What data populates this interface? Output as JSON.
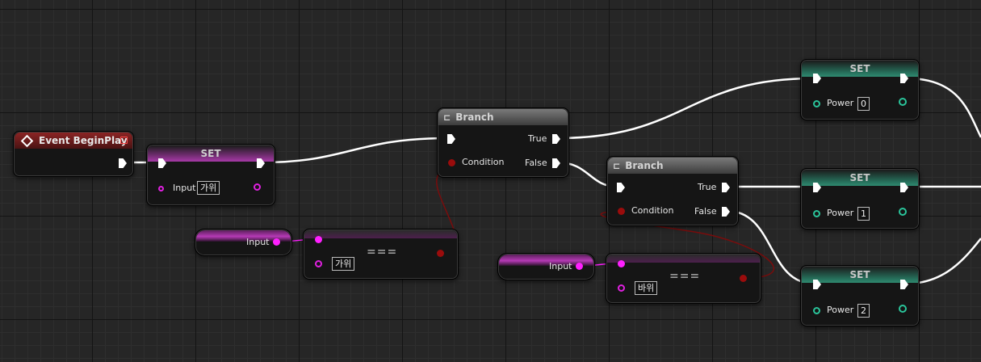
{
  "event_node": {
    "title": "Event BeginPlay"
  },
  "set_input": {
    "title": "SET",
    "pin_label": "Input",
    "value": "가위"
  },
  "get_input_1": {
    "label": "Input"
  },
  "equal_1": {
    "value": "가위",
    "symbol": "==="
  },
  "branch_1": {
    "title": "Branch",
    "true_label": "True",
    "false_label": "False",
    "condition_label": "Condition"
  },
  "branch_2": {
    "title": "Branch",
    "true_label": "True",
    "false_label": "False",
    "condition_label": "Condition"
  },
  "get_input_2": {
    "label": "Input"
  },
  "equal_2": {
    "value": "바위",
    "symbol": "==="
  },
  "set_power_0": {
    "title": "SET",
    "pin_label": "Power",
    "value": "0"
  },
  "set_power_1": {
    "title": "SET",
    "pin_label": "Power",
    "value": "1"
  },
  "set_power_2": {
    "title": "SET",
    "pin_label": "Power",
    "value": "2"
  },
  "colors": {
    "exec_wire": "#ffffff",
    "string_pin": "#ff20ff",
    "bool_pin": "#9a0c0c",
    "int_pin": "#2ac49a",
    "event_header": "#8b2424"
  }
}
